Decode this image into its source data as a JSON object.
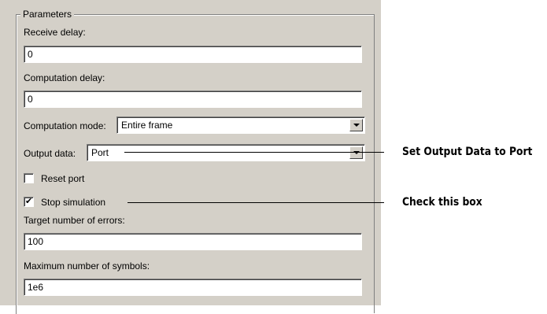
{
  "parameters": {
    "group_label": "Parameters",
    "receive_delay": {
      "label": "Receive delay:",
      "value": "0"
    },
    "computation_delay": {
      "label": "Computation delay:",
      "value": "0"
    },
    "computation_mode": {
      "label": "Computation mode:",
      "value": "Entire frame"
    },
    "output_data": {
      "label": "Output data:",
      "value": "Port"
    },
    "reset_port": {
      "label": "Reset port",
      "checked": false
    },
    "stop_simulation": {
      "label": "Stop simulation",
      "checked": true,
      "check_glyph": "✔"
    },
    "target_errors": {
      "label": "Target number of errors:",
      "value": "100"
    },
    "max_symbols": {
      "label": "Maximum number of symbols:",
      "value": "1e6"
    }
  },
  "callouts": {
    "output_data_note": "Set Output Data to Port",
    "stop_simulation_note": "Check this box"
  },
  "icons": {
    "combo_arrow": "chevron-down-icon",
    "checkmark": "checkmark-icon"
  }
}
